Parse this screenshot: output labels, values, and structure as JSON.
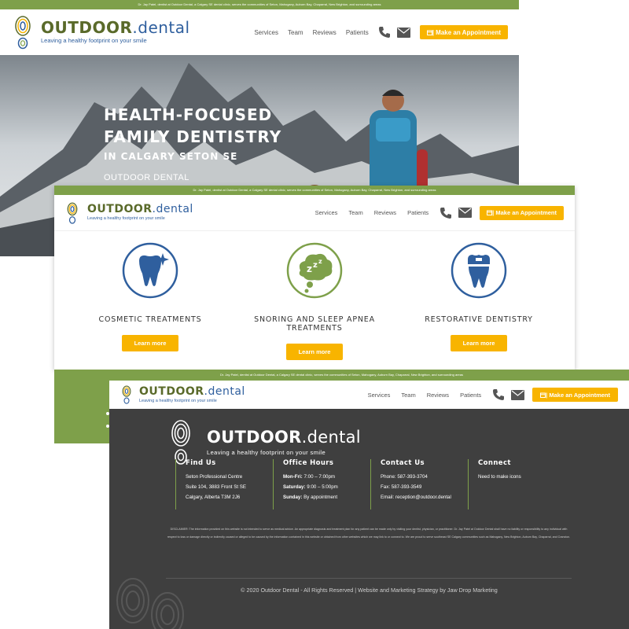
{
  "site": {
    "announcement": "Dr. Jay Patel, dentist at Outdoor Dental, a Calgary SE dental clinic, serves the communities of Seton, Mahogany, Auburn Bay, Chaparral, New Brighton, and surrounding areas",
    "brand_part1": "OUTDOOR",
    "brand_part2": ".dental",
    "tagline": "Leaving a healthy footprint on your smile",
    "nav": [
      "Services",
      "Team",
      "Reviews",
      "Patients"
    ],
    "cta": "| Make an Appointment",
    "colors": {
      "green": "#7ea04a",
      "blue": "#2f5f9e",
      "yellow": "#f8b400",
      "dark": "#3f3f3f"
    },
    "icons": {
      "phone": "phone-icon",
      "email": "envelope-icon",
      "calendar": "calendar-icon"
    }
  },
  "hero": {
    "line1": "HEALTH-FOCUSED",
    "line2": "FAMILY DENTISTRY",
    "line3": "IN CALGARY SETON SE",
    "subtitle": "OUTDOOR DENTAL"
  },
  "services": [
    {
      "title": "COSMETIC TREATMENTS",
      "button": "Learn more",
      "icon": "sparkling-tooth-icon"
    },
    {
      "title": "SNORING AND SLEEP APNEA TREATMENTS",
      "button": "Learn more",
      "icon": "sleep-zzz-icon"
    },
    {
      "title": "RESTORATIVE DENTISTRY",
      "button": "Learn more",
      "icon": "crowned-tooth-icon"
    }
  ],
  "footer": {
    "brand_part1": "OUTDOOR",
    "brand_part2": ".dental",
    "tagline": "Leaving a healthy footprint on your smile",
    "find_us": {
      "heading": "Find Us",
      "lines": [
        "Seton Professional Centre",
        "Suite 104, 3883 Front St SE",
        "Calgary, Alberta T3M 2J6"
      ]
    },
    "office_hours": {
      "heading": "Office Hours",
      "rows": [
        {
          "day": "Mon-Fri:",
          "time": "7:00 – 7:00pm"
        },
        {
          "day": "Saturday:",
          "time": "9:00 – 5:00pm"
        },
        {
          "day": "Sunday:",
          "time": "By appointment"
        }
      ]
    },
    "contact_us": {
      "heading": "Contact Us",
      "lines": [
        "Phone: 587-393-3704",
        "Fax: 587-393-3549",
        "Email: reception@outdoor.dental"
      ]
    },
    "connect": {
      "heading": "Connect",
      "lines": [
        "Need to make icons"
      ]
    },
    "disclaimer": "DISCLAIMER: The information provided on this website is not intended to serve as medical advice. An appropriate diagnosis and treatment plan for any patient can be made only by visiting your dentist, physician, or practitioner. Dr. Jay Patel at Outdoor Dental shall have no liability or responsibility to any individual with respect to loss or damage directly or indirectly caused or alleged to be caused by the information contained in this website or obtained from other websites which we may link to or connect to. We are proud to serve southeast SE Calgary communities such as Mahogany, New Brighton, Auburn Bay, Chaparral, and Cranston.",
    "copyright": "© 2020 Outdoor Dental - All Rights Reserved | Website and Marketing Strategy by Jaw Drop Marketing"
  }
}
